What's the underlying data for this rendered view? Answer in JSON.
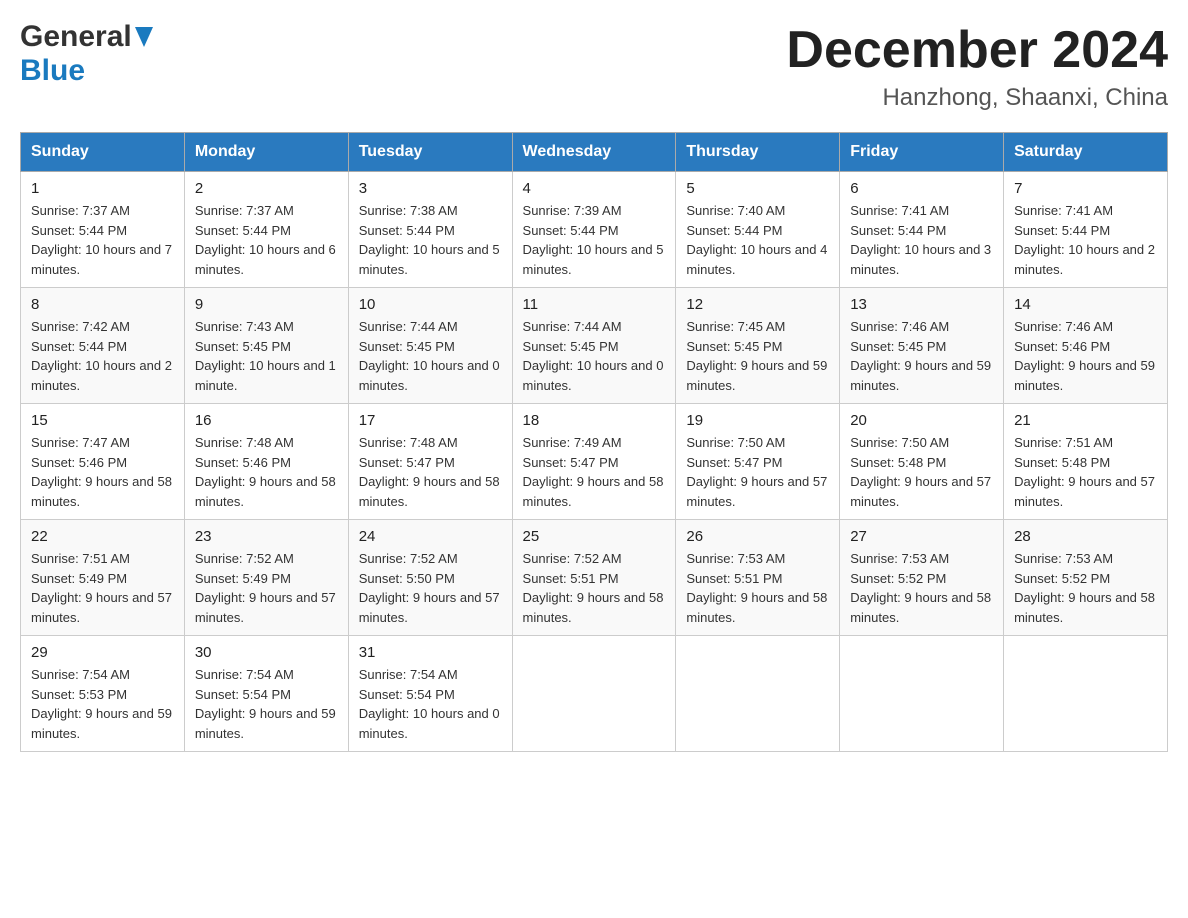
{
  "header": {
    "title": "December 2024",
    "subtitle": "Hanzhong, Shaanxi, China",
    "logo_general": "General",
    "logo_blue": "Blue"
  },
  "weekdays": [
    "Sunday",
    "Monday",
    "Tuesday",
    "Wednesday",
    "Thursday",
    "Friday",
    "Saturday"
  ],
  "weeks": [
    [
      {
        "day": "1",
        "sunrise": "7:37 AM",
        "sunset": "5:44 PM",
        "daylight": "10 hours and 7 minutes."
      },
      {
        "day": "2",
        "sunrise": "7:37 AM",
        "sunset": "5:44 PM",
        "daylight": "10 hours and 6 minutes."
      },
      {
        "day": "3",
        "sunrise": "7:38 AM",
        "sunset": "5:44 PM",
        "daylight": "10 hours and 5 minutes."
      },
      {
        "day": "4",
        "sunrise": "7:39 AM",
        "sunset": "5:44 PM",
        "daylight": "10 hours and 5 minutes."
      },
      {
        "day": "5",
        "sunrise": "7:40 AM",
        "sunset": "5:44 PM",
        "daylight": "10 hours and 4 minutes."
      },
      {
        "day": "6",
        "sunrise": "7:41 AM",
        "sunset": "5:44 PM",
        "daylight": "10 hours and 3 minutes."
      },
      {
        "day": "7",
        "sunrise": "7:41 AM",
        "sunset": "5:44 PM",
        "daylight": "10 hours and 2 minutes."
      }
    ],
    [
      {
        "day": "8",
        "sunrise": "7:42 AM",
        "sunset": "5:44 PM",
        "daylight": "10 hours and 2 minutes."
      },
      {
        "day": "9",
        "sunrise": "7:43 AM",
        "sunset": "5:45 PM",
        "daylight": "10 hours and 1 minute."
      },
      {
        "day": "10",
        "sunrise": "7:44 AM",
        "sunset": "5:45 PM",
        "daylight": "10 hours and 0 minutes."
      },
      {
        "day": "11",
        "sunrise": "7:44 AM",
        "sunset": "5:45 PM",
        "daylight": "10 hours and 0 minutes."
      },
      {
        "day": "12",
        "sunrise": "7:45 AM",
        "sunset": "5:45 PM",
        "daylight": "9 hours and 59 minutes."
      },
      {
        "day": "13",
        "sunrise": "7:46 AM",
        "sunset": "5:45 PM",
        "daylight": "9 hours and 59 minutes."
      },
      {
        "day": "14",
        "sunrise": "7:46 AM",
        "sunset": "5:46 PM",
        "daylight": "9 hours and 59 minutes."
      }
    ],
    [
      {
        "day": "15",
        "sunrise": "7:47 AM",
        "sunset": "5:46 PM",
        "daylight": "9 hours and 58 minutes."
      },
      {
        "day": "16",
        "sunrise": "7:48 AM",
        "sunset": "5:46 PM",
        "daylight": "9 hours and 58 minutes."
      },
      {
        "day": "17",
        "sunrise": "7:48 AM",
        "sunset": "5:47 PM",
        "daylight": "9 hours and 58 minutes."
      },
      {
        "day": "18",
        "sunrise": "7:49 AM",
        "sunset": "5:47 PM",
        "daylight": "9 hours and 58 minutes."
      },
      {
        "day": "19",
        "sunrise": "7:50 AM",
        "sunset": "5:47 PM",
        "daylight": "9 hours and 57 minutes."
      },
      {
        "day": "20",
        "sunrise": "7:50 AM",
        "sunset": "5:48 PM",
        "daylight": "9 hours and 57 minutes."
      },
      {
        "day": "21",
        "sunrise": "7:51 AM",
        "sunset": "5:48 PM",
        "daylight": "9 hours and 57 minutes."
      }
    ],
    [
      {
        "day": "22",
        "sunrise": "7:51 AM",
        "sunset": "5:49 PM",
        "daylight": "9 hours and 57 minutes."
      },
      {
        "day": "23",
        "sunrise": "7:52 AM",
        "sunset": "5:49 PM",
        "daylight": "9 hours and 57 minutes."
      },
      {
        "day": "24",
        "sunrise": "7:52 AM",
        "sunset": "5:50 PM",
        "daylight": "9 hours and 57 minutes."
      },
      {
        "day": "25",
        "sunrise": "7:52 AM",
        "sunset": "5:51 PM",
        "daylight": "9 hours and 58 minutes."
      },
      {
        "day": "26",
        "sunrise": "7:53 AM",
        "sunset": "5:51 PM",
        "daylight": "9 hours and 58 minutes."
      },
      {
        "day": "27",
        "sunrise": "7:53 AM",
        "sunset": "5:52 PM",
        "daylight": "9 hours and 58 minutes."
      },
      {
        "day": "28",
        "sunrise": "7:53 AM",
        "sunset": "5:52 PM",
        "daylight": "9 hours and 58 minutes."
      }
    ],
    [
      {
        "day": "29",
        "sunrise": "7:54 AM",
        "sunset": "5:53 PM",
        "daylight": "9 hours and 59 minutes."
      },
      {
        "day": "30",
        "sunrise": "7:54 AM",
        "sunset": "5:54 PM",
        "daylight": "9 hours and 59 minutes."
      },
      {
        "day": "31",
        "sunrise": "7:54 AM",
        "sunset": "5:54 PM",
        "daylight": "10 hours and 0 minutes."
      },
      null,
      null,
      null,
      null
    ]
  ]
}
